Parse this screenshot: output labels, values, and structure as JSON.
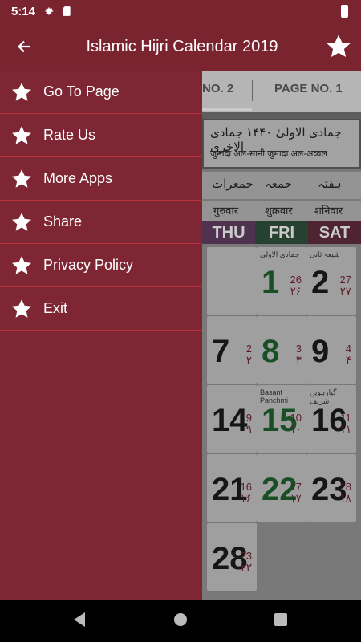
{
  "status_bar": {
    "time": "5:14",
    "icons": [
      "gear-icon",
      "sd-card-icon",
      "battery-charging-icon"
    ]
  },
  "app_bar": {
    "title": "Islamic Hijri Calendar 2019",
    "back_icon": "arrow-left-icon",
    "action_icon": "star-icon",
    "color": "#7a2430"
  },
  "tabs": [
    {
      "label": "NO. 2"
    },
    {
      "label": "PAGE NO. 1"
    }
  ],
  "calendar": {
    "header_urdu": "جمادی الاولیٰ  ۱۴۴۰  جمادی الاخریٰ",
    "header_hindi": "जुमादा अल-सानी  जुमादा अल-अव्वल",
    "days_urdu": [
      "جمعرات",
      "جمعہ",
      "ہفتہ"
    ],
    "days_hindi": [
      "गुरुवार",
      "शुक्रवार",
      "शनिवार"
    ],
    "days_english": [
      "THU",
      "FRI",
      "SAT"
    ],
    "cells": [
      {
        "day": "1",
        "hijri": "26",
        "hijri_urdu": "۲۶",
        "note": "جمادی الاولیٰ",
        "green": true
      },
      {
        "day": "2",
        "hijri": "27",
        "hijri_urdu": "۲۷",
        "note": "شیعہ ثانی",
        "green": false
      },
      {
        "day": "7",
        "hijri": "2",
        "hijri_urdu": "۲",
        "note": "",
        "green": false
      },
      {
        "day": "8",
        "hijri": "3",
        "hijri_urdu": "۳",
        "note": "",
        "green": true
      },
      {
        "day": "9",
        "hijri": "4",
        "hijri_urdu": "۴",
        "note": "",
        "green": false
      },
      {
        "day": "14",
        "hijri": "9",
        "hijri_urdu": "۹",
        "note": "",
        "green": false
      },
      {
        "day": "15",
        "hijri": "10",
        "hijri_urdu": "۱۰",
        "note": "Basant Panchmi",
        "green": true
      },
      {
        "day": "16",
        "hijri": "11",
        "hijri_urdu": "۱۱",
        "note": "گیارہویں شریف",
        "green": false
      },
      {
        "day": "21",
        "hijri": "16",
        "hijri_urdu": "۱۶",
        "note": "",
        "green": false
      },
      {
        "day": "22",
        "hijri": "17",
        "hijri_urdu": "۱۷",
        "note": "",
        "green": true
      },
      {
        "day": "23",
        "hijri": "18",
        "hijri_urdu": "۱۸",
        "note": "",
        "green": false
      },
      {
        "day": "28",
        "hijri": "23",
        "hijri_urdu": "۲۳",
        "note": "",
        "green": false
      }
    ]
  },
  "drawer": {
    "items": [
      {
        "label": "Go To Page",
        "icon": "star-icon"
      },
      {
        "label": "Rate Us",
        "icon": "star-icon"
      },
      {
        "label": "More Apps",
        "icon": "star-icon"
      },
      {
        "label": "Share",
        "icon": "star-icon"
      },
      {
        "label": "Privacy Policy",
        "icon": "star-icon"
      },
      {
        "label": "Exit",
        "icon": "star-icon"
      }
    ],
    "bg_color": "#7e2633",
    "divider_color": "#b8303c"
  },
  "nav_bar": {
    "buttons": [
      "back-triangle-icon",
      "home-circle-icon",
      "recents-square-icon"
    ]
  }
}
